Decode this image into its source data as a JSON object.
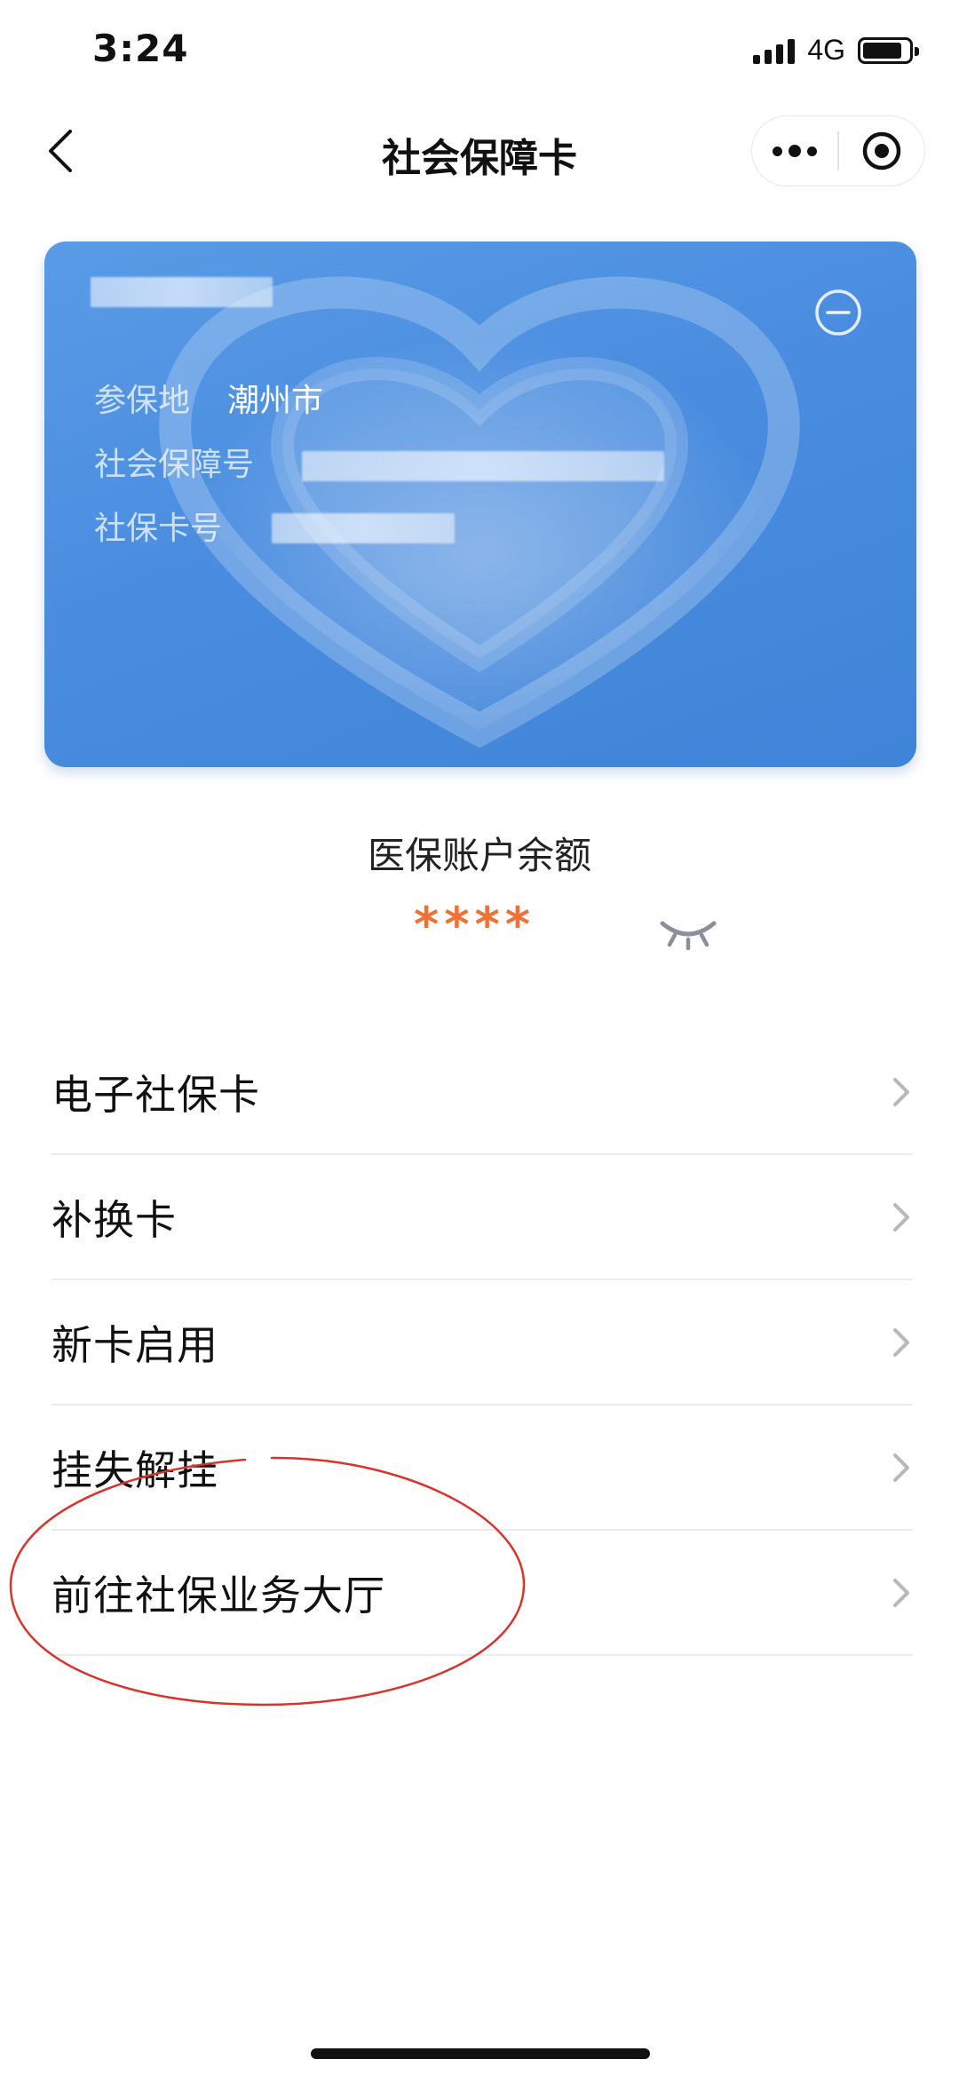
{
  "status_bar": {
    "time": "3:24",
    "network": "4G",
    "battery_level": 0.85
  },
  "nav": {
    "title": "社会保障卡",
    "back_icon": "chevron-left-icon",
    "more_icon": "more-dots-icon",
    "close_icon": "target-circle-icon"
  },
  "card": {
    "place_label": "参保地",
    "place_value": "潮州市",
    "ssn_label": "社会保障号",
    "card_no_label": "社保卡号",
    "collapse_icon": "minus-circle-icon",
    "color_start": "#5a9be6",
    "color_end": "#3f84d8"
  },
  "balance": {
    "title": "医保账户余额",
    "masked_value": "****",
    "value_color": "#f07035",
    "toggle_icon": "eye-closed-icon"
  },
  "menu": {
    "items": [
      {
        "label": "电子社保卡"
      },
      {
        "label": "补换卡"
      },
      {
        "label": "新卡启用"
      },
      {
        "label": "挂失解挂"
      },
      {
        "label": "前往社保业务大厅"
      }
    ],
    "chevron_icon": "chevron-right-icon"
  },
  "annotation": {
    "color": "#d9332b"
  }
}
